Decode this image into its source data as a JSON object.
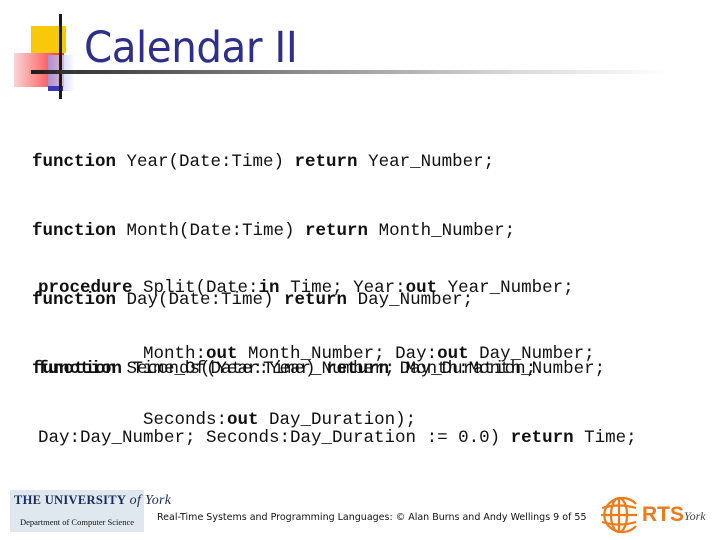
{
  "slide": {
    "title": "Calendar II",
    "functions": [
      {
        "kw": "function",
        "sig": " Year(Date:Time) ",
        "ret": "return",
        "type": " Year_Number;"
      },
      {
        "kw": "function",
        "sig": " Month(Date:Time) ",
        "ret": "return",
        "type": " Month_Number;"
      },
      {
        "kw": "function",
        "sig": " Day(Date:Time) ",
        "ret": "return",
        "type": " Day_Number;"
      },
      {
        "kw": "function",
        "sig": " Seconds(Date:Time) ",
        "ret": "return",
        "type": " Day_Duration;"
      }
    ],
    "split": {
      "l1_kw": "procedure",
      "l1_a": " Split(Date:",
      "l1_in": "in",
      "l1_b": " Time; Year:",
      "l1_out": "out",
      "l1_c": " Year_Number;",
      "l2_a": "          Month:",
      "l2_out1": "out",
      "l2_b": " Month_Number; Day:",
      "l2_out2": "out",
      "l2_c": " Day_Number;",
      "l3_a": "          Seconds:",
      "l3_out": "out",
      "l3_b": " Day_Duration);"
    },
    "time_of": {
      "l1_kw": "function",
      "l1_a": " Time_Of(Year:Year_Number; Month:Month_Number;",
      "l2_a": "Day:Day_Number; Seconds:Day_Duration := 0.0) ",
      "l2_ret": "return",
      "l2_b": " Time;"
    }
  },
  "footer": {
    "text": "Real-Time Systems and Programming Languages: © Alan Burns and Andy Wellings 9 of 55",
    "university_name": "The University",
    "university_of_york": "of York",
    "department": "Department of Computer Science",
    "rts_label": "RTS",
    "rts_york": "York"
  }
}
